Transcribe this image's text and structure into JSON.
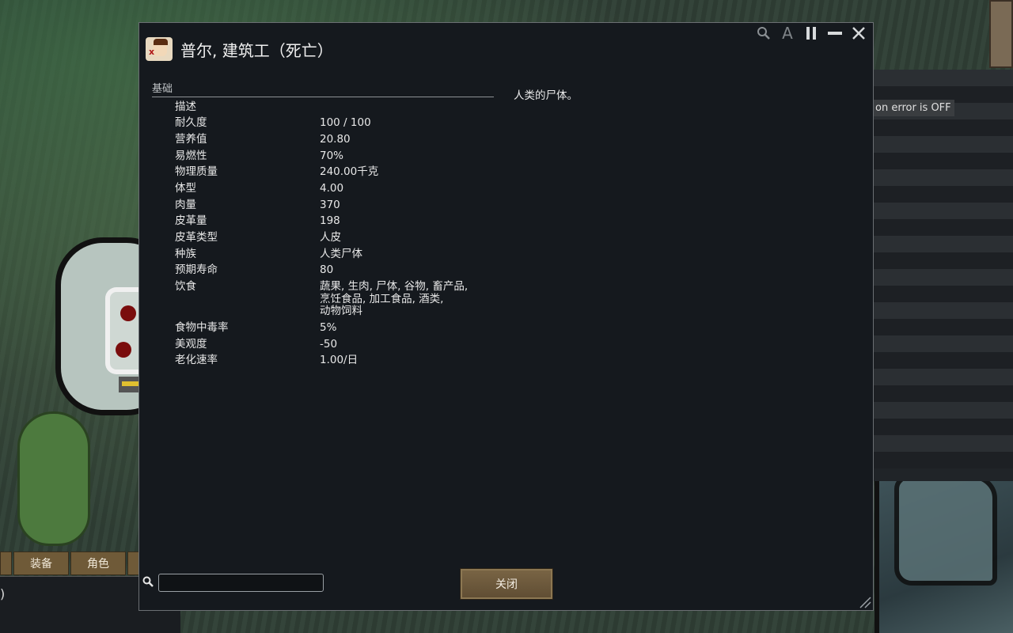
{
  "dialog": {
    "title": "普尔, 建筑工（死亡）",
    "controls": {
      "search_icon": "search-icon",
      "font_icon": "A",
      "pause_icon": "pause-icon",
      "minimize_icon": "minimize-icon",
      "close_icon": "close-icon"
    },
    "section_title": "基础",
    "stats": [
      {
        "label": "描述",
        "value": ""
      },
      {
        "label": "耐久度",
        "value": "100 / 100"
      },
      {
        "label": "营养值",
        "value": "20.80"
      },
      {
        "label": "易燃性",
        "value": "70%"
      },
      {
        "label": "物理质量",
        "value": "240.00千克"
      },
      {
        "label": "体型",
        "value": "4.00"
      },
      {
        "label": "肉量",
        "value": "370"
      },
      {
        "label": "皮革量",
        "value": "198"
      },
      {
        "label": "皮革类型",
        "value": "人皮"
      },
      {
        "label": "种族",
        "value": "人类尸体"
      },
      {
        "label": "预期寿命",
        "value": "80"
      },
      {
        "label": "饮食",
        "value": "蔬果, 生肉, 尸体, 谷物, 畜产品,\n烹饪食品, 加工食品, 酒类,\n动物饲料"
      },
      {
        "label": "食物中毒率",
        "value": "5%"
      },
      {
        "label": "美观度",
        "value": "-50"
      },
      {
        "label": "老化速率",
        "value": "1.00/日"
      }
    ],
    "description": "人类的尸体。",
    "search": {
      "value": "",
      "placeholder": ""
    },
    "close_label": "关闭"
  },
  "background": {
    "error_badge": "on error is OFF",
    "tabs": [
      "装备",
      "角色"
    ],
    "bottom_left_text": ")"
  }
}
